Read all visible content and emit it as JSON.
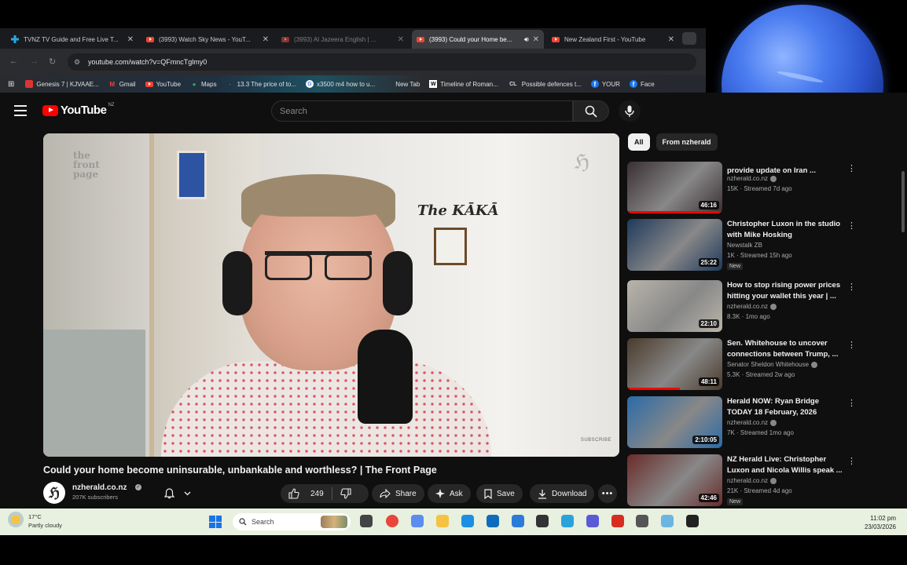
{
  "tabs": [
    {
      "title": "TVNZ TV Guide and Free Live T...",
      "favicon": "tvnz-icon",
      "active": false
    },
    {
      "title": "(3993) Watch Sky News - YouT...",
      "favicon": "youtube-icon",
      "active": false
    },
    {
      "title": "(3993) Al Jazeera English | ...",
      "favicon": "youtube-icon",
      "active": false
    },
    {
      "title": "(3993) Could your Home be...",
      "favicon": "youtube-icon",
      "active": true
    },
    {
      "title": "New Zealand First - YouTube",
      "favicon": "youtube-icon",
      "active": false
    }
  ],
  "address_bar": {
    "url": "youtube.com/watch?v=QFmncTglmy0"
  },
  "bookmarks": [
    {
      "label": "Genesis 7 | KJVAAE...",
      "icon": "page-icon"
    },
    {
      "label": "Gmail",
      "icon": "gmail-icon"
    },
    {
      "label": "YouTube",
      "icon": "youtube-icon"
    },
    {
      "label": "Maps",
      "icon": "maps-icon"
    },
    {
      "label": "13.3 The price of to...",
      "icon": "page-icon"
    },
    {
      "label": "x3500 m4 how to u...",
      "icon": "google-icon"
    },
    {
      "label": "New Tab",
      "icon": "page-icon"
    },
    {
      "label": "Timeline of Roman...",
      "icon": "wikipedia-icon"
    },
    {
      "label": "Possible defences t...",
      "icon": "cl-icon"
    },
    {
      "label": "YOUR",
      "icon": "facebook-icon"
    },
    {
      "label": "Face",
      "icon": "facebook-icon"
    }
  ],
  "youtube": {
    "logo_text": "YouTube",
    "country_code": "NZ",
    "search_placeholder": "Search"
  },
  "player": {
    "brand_watermark": "the front page",
    "wall_sign": "The KĀKĀ",
    "subscribe_watermark": "SUBSCRIBE"
  },
  "video": {
    "title": "Could your home become uninsurable, unbankable and worthless? | The Front Page",
    "channel": "nzherald.co.nz",
    "subscribers": "207K subscribers",
    "likes": "249",
    "share_label": "Share",
    "ask_label": "Ask",
    "save_label": "Save",
    "download_label": "Download"
  },
  "chips": [
    {
      "label": "All",
      "selected": true
    },
    {
      "label": "From nzherald",
      "selected": false
    }
  ],
  "recommendations": [
    {
      "title": "provide update on Iran ...",
      "channel": "nzherald.co.nz",
      "verified": true,
      "meta": "15K · Streamed 7d ago",
      "duration": "46:16",
      "new": false,
      "progress": 1.0,
      "thumb": "#3a2f33"
    },
    {
      "title": "Christopher Luxon in the studio with Mike Hosking",
      "channel": "Newstalk ZB",
      "verified": false,
      "meta": "1K · Streamed 15h ago",
      "duration": "25:22",
      "new": true,
      "new_label": "New",
      "progress": 0,
      "thumb": "#1f3a5c"
    },
    {
      "title": "How to stop rising power prices hitting your wallet this year | ...",
      "channel": "nzherald.co.nz",
      "verified": true,
      "meta": "8.3K · 1mo ago",
      "duration": "22:10",
      "new": false,
      "progress": 0,
      "thumb": "#b9b4aa"
    },
    {
      "title": "Sen. Whitehouse to uncover connections between Trump, ...",
      "channel": "Senator Sheldon Whitehouse",
      "verified": true,
      "meta": "5.3K · Streamed 2w ago",
      "duration": "48:11",
      "new": false,
      "progress": 0.55,
      "thumb": "#4a3b2c"
    },
    {
      "title": "Herald NOW: Ryan Bridge TODAY 18 February, 2026",
      "channel": "nzherald.co.nz",
      "verified": true,
      "meta": "7K · Streamed 1mo ago",
      "duration": "2:10:05",
      "new": false,
      "progress": 0,
      "thumb": "#2a6ba8"
    },
    {
      "title": "NZ Herald Live: Christopher Luxon and Nicola Willis speak ...",
      "channel": "nzherald.co.nz",
      "verified": true,
      "meta": "21K · Streamed 4d ago",
      "duration": "42:46",
      "new": true,
      "new_label": "New",
      "progress": 0,
      "thumb": "#6a2b2b"
    }
  ],
  "taskbar": {
    "weather_temp": "17°C",
    "weather_condition": "Partly cloudy",
    "search_placeholder": "Search",
    "time": "11:02 pm",
    "date": "23/03/2026",
    "apps": [
      "file-explorer-icon",
      "chrome-icon",
      "copilot-icon",
      "folder-icon",
      "edge-icon",
      "outlook-icon",
      "store-icon",
      "terminal-icon",
      "telegram-icon",
      "app-icon",
      "media-icon",
      "gamepad-icon",
      "network-icon",
      "obs-icon"
    ]
  },
  "colors": {
    "youtube_red": "#ff0000",
    "background": "#0f0f0f",
    "taskbar": "#e8f0df",
    "planet": "#2c55cf"
  }
}
